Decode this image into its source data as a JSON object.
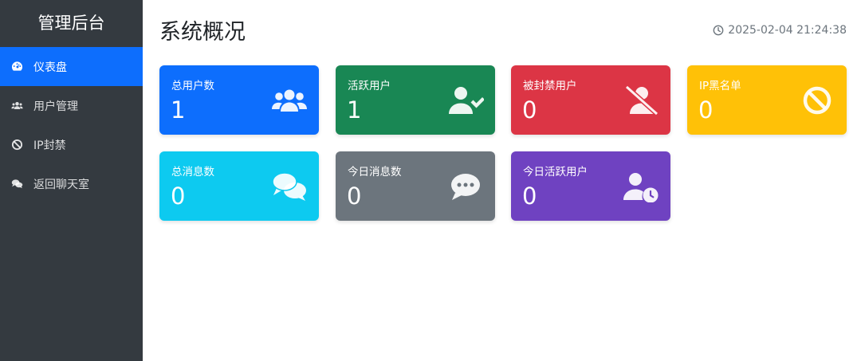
{
  "sidebar": {
    "brand": "管理后台",
    "items": [
      {
        "label": "仪表盘",
        "icon": "tachometer-icon",
        "active": true
      },
      {
        "label": "用户管理",
        "icon": "users-icon",
        "active": false
      },
      {
        "label": "IP封禁",
        "icon": "ban-icon",
        "active": false
      },
      {
        "label": "返回聊天室",
        "icon": "comments-icon",
        "active": false
      }
    ]
  },
  "header": {
    "title": "系统概况",
    "datetime": "2025-02-04 21:24:38"
  },
  "cards": [
    {
      "label": "总用户数",
      "value": "1",
      "color": "#0d6efd",
      "icon": "users-icon"
    },
    {
      "label": "活跃用户",
      "value": "1",
      "color": "#198754",
      "icon": "user-check-icon"
    },
    {
      "label": "被封禁用户",
      "value": "0",
      "color": "#dc3545",
      "icon": "user-slash-icon"
    },
    {
      "label": "IP黑名单",
      "value": "0",
      "color": "#ffc107",
      "icon": "ban-icon"
    },
    {
      "label": "总消息数",
      "value": "0",
      "color": "#0dcaf0",
      "icon": "comments-icon"
    },
    {
      "label": "今日消息数",
      "value": "0",
      "color": "#6c757d",
      "icon": "comment-dots-icon"
    },
    {
      "label": "今日活跃用户",
      "value": "0",
      "color": "#6f42c1",
      "icon": "user-clock-icon"
    }
  ],
  "colors": {
    "sidebar_bg": "#343a40",
    "accent": "#0d6efd"
  }
}
